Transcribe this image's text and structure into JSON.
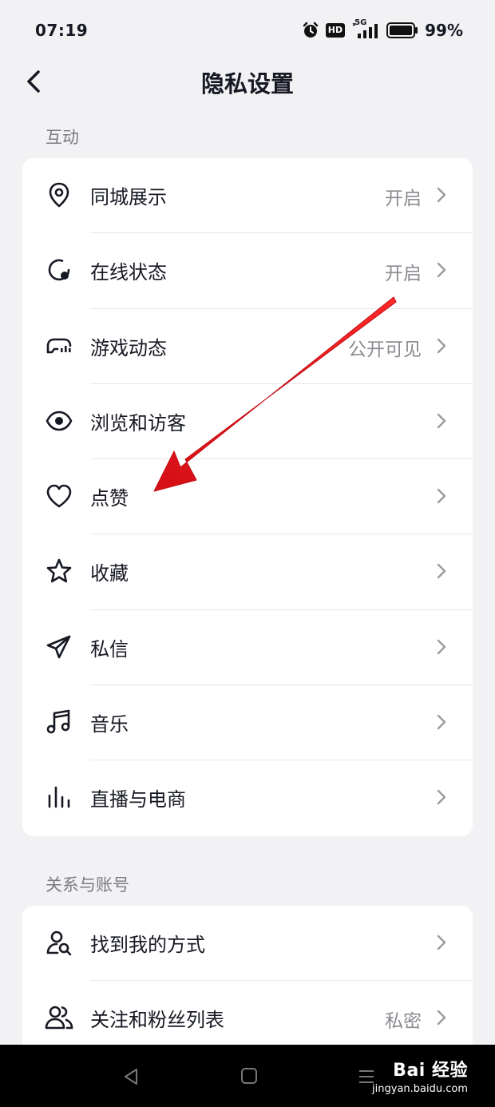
{
  "status_bar": {
    "time": "07:19",
    "hd_badge": "HD",
    "network": "5G",
    "battery_percent": "99%",
    "icons": [
      "alarm-icon",
      "hd-icon",
      "signal-5g-icon",
      "battery-icon"
    ]
  },
  "header": {
    "title": "隐私设置",
    "back_icon": "chevron-left-icon"
  },
  "sections": [
    {
      "title": "互动",
      "items": [
        {
          "label": "同城展示",
          "value": "开启",
          "icon": "location-pin-icon"
        },
        {
          "label": "在线状态",
          "value": "开启",
          "icon": "online-status-icon"
        },
        {
          "label": "游戏动态",
          "value": "公开可见",
          "icon": "game-controller-icon"
        },
        {
          "label": "浏览和访客",
          "value": "",
          "icon": "eye-icon"
        },
        {
          "label": "点赞",
          "value": "",
          "icon": "heart-icon"
        },
        {
          "label": "收藏",
          "value": "",
          "icon": "star-icon"
        },
        {
          "label": "私信",
          "value": "",
          "icon": "paper-plane-icon"
        },
        {
          "label": "音乐",
          "value": "",
          "icon": "music-note-icon"
        },
        {
          "label": "直播与电商",
          "value": "",
          "icon": "live-bars-icon"
        }
      ]
    },
    {
      "title": "关系与账号",
      "items": [
        {
          "label": "找到我的方式",
          "value": "",
          "icon": "user-search-icon"
        },
        {
          "label": "关注和粉丝列表",
          "value": "私密",
          "icon": "users-icon"
        }
      ]
    }
  ],
  "annotation": {
    "arrow_color": "#e8141b",
    "points_to": "点赞"
  },
  "bottom_nav": {
    "buttons": [
      "back-triangle-icon",
      "home-square-icon",
      "menu-lines-icon"
    ]
  },
  "watermark": {
    "brand": "Bai 经验",
    "url": "jingyan.baidu.com"
  },
  "colors": {
    "background": "#f2f2f4",
    "card": "#ffffff",
    "text_primary": "#161823",
    "text_secondary": "#8a8b91",
    "section_header": "#7a7b80",
    "divider": "#e6e6e8"
  }
}
